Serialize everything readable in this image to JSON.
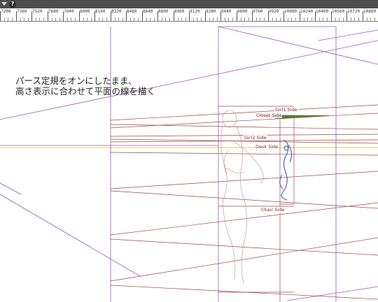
{
  "toolbar": {
    "menu_icon": "triangle-down-icon",
    "help_glyph": "?"
  },
  "ruler": {
    "labels": [
      "7200",
      "7360",
      "7520",
      "7680",
      "7840",
      "8000",
      "8160",
      "8320",
      "8480",
      "8640",
      "8800",
      "8960",
      "9120",
      "9280",
      "9440",
      "9600",
      "9760",
      "9920",
      "10080",
      "10240",
      "10400",
      "10560",
      "10720",
      "10880"
    ]
  },
  "annotation": {
    "line1": "パース定規をオンにしたまま、",
    "line2": "高さ表示に合わせて平面の線を描く"
  },
  "labels": {
    "girl1": "Girl1 Side",
    "closet": "Closet Side",
    "girl2": "Girl2 Side",
    "desk": "Desk Side",
    "chair": "Chair Side"
  },
  "colors": {
    "guide_purple": "#9a5ab8",
    "guide_red": "#a04a4a",
    "guide_yellow": "#d8d060",
    "sketch_blue": "#5a6aaa",
    "plane_green": "#5a7a3a"
  }
}
